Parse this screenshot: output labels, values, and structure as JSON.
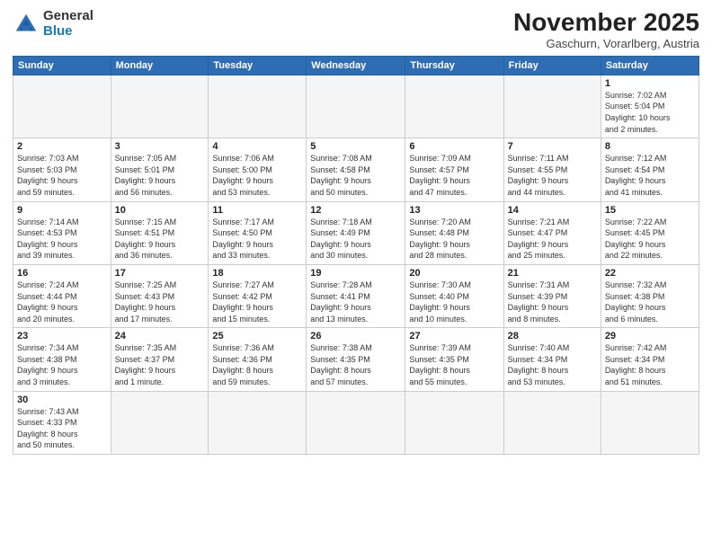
{
  "logo": {
    "text_general": "General",
    "text_blue": "Blue"
  },
  "title": "November 2025",
  "subtitle": "Gaschurn, Vorarlberg, Austria",
  "days_of_week": [
    "Sunday",
    "Monday",
    "Tuesday",
    "Wednesday",
    "Thursday",
    "Friday",
    "Saturday"
  ],
  "weeks": [
    [
      {
        "day": "",
        "info": ""
      },
      {
        "day": "",
        "info": ""
      },
      {
        "day": "",
        "info": ""
      },
      {
        "day": "",
        "info": ""
      },
      {
        "day": "",
        "info": ""
      },
      {
        "day": "",
        "info": ""
      },
      {
        "day": "1",
        "info": "Sunrise: 7:02 AM\nSunset: 5:04 PM\nDaylight: 10 hours\nand 2 minutes."
      }
    ],
    [
      {
        "day": "2",
        "info": "Sunrise: 7:03 AM\nSunset: 5:03 PM\nDaylight: 9 hours\nand 59 minutes."
      },
      {
        "day": "3",
        "info": "Sunrise: 7:05 AM\nSunset: 5:01 PM\nDaylight: 9 hours\nand 56 minutes."
      },
      {
        "day": "4",
        "info": "Sunrise: 7:06 AM\nSunset: 5:00 PM\nDaylight: 9 hours\nand 53 minutes."
      },
      {
        "day": "5",
        "info": "Sunrise: 7:08 AM\nSunset: 4:58 PM\nDaylight: 9 hours\nand 50 minutes."
      },
      {
        "day": "6",
        "info": "Sunrise: 7:09 AM\nSunset: 4:57 PM\nDaylight: 9 hours\nand 47 minutes."
      },
      {
        "day": "7",
        "info": "Sunrise: 7:11 AM\nSunset: 4:55 PM\nDaylight: 9 hours\nand 44 minutes."
      },
      {
        "day": "8",
        "info": "Sunrise: 7:12 AM\nSunset: 4:54 PM\nDaylight: 9 hours\nand 41 minutes."
      }
    ],
    [
      {
        "day": "9",
        "info": "Sunrise: 7:14 AM\nSunset: 4:53 PM\nDaylight: 9 hours\nand 39 minutes."
      },
      {
        "day": "10",
        "info": "Sunrise: 7:15 AM\nSunset: 4:51 PM\nDaylight: 9 hours\nand 36 minutes."
      },
      {
        "day": "11",
        "info": "Sunrise: 7:17 AM\nSunset: 4:50 PM\nDaylight: 9 hours\nand 33 minutes."
      },
      {
        "day": "12",
        "info": "Sunrise: 7:18 AM\nSunset: 4:49 PM\nDaylight: 9 hours\nand 30 minutes."
      },
      {
        "day": "13",
        "info": "Sunrise: 7:20 AM\nSunset: 4:48 PM\nDaylight: 9 hours\nand 28 minutes."
      },
      {
        "day": "14",
        "info": "Sunrise: 7:21 AM\nSunset: 4:47 PM\nDaylight: 9 hours\nand 25 minutes."
      },
      {
        "day": "15",
        "info": "Sunrise: 7:22 AM\nSunset: 4:45 PM\nDaylight: 9 hours\nand 22 minutes."
      }
    ],
    [
      {
        "day": "16",
        "info": "Sunrise: 7:24 AM\nSunset: 4:44 PM\nDaylight: 9 hours\nand 20 minutes."
      },
      {
        "day": "17",
        "info": "Sunrise: 7:25 AM\nSunset: 4:43 PM\nDaylight: 9 hours\nand 17 minutes."
      },
      {
        "day": "18",
        "info": "Sunrise: 7:27 AM\nSunset: 4:42 PM\nDaylight: 9 hours\nand 15 minutes."
      },
      {
        "day": "19",
        "info": "Sunrise: 7:28 AM\nSunset: 4:41 PM\nDaylight: 9 hours\nand 13 minutes."
      },
      {
        "day": "20",
        "info": "Sunrise: 7:30 AM\nSunset: 4:40 PM\nDaylight: 9 hours\nand 10 minutes."
      },
      {
        "day": "21",
        "info": "Sunrise: 7:31 AM\nSunset: 4:39 PM\nDaylight: 9 hours\nand 8 minutes."
      },
      {
        "day": "22",
        "info": "Sunrise: 7:32 AM\nSunset: 4:38 PM\nDaylight: 9 hours\nand 6 minutes."
      }
    ],
    [
      {
        "day": "23",
        "info": "Sunrise: 7:34 AM\nSunset: 4:38 PM\nDaylight: 9 hours\nand 3 minutes."
      },
      {
        "day": "24",
        "info": "Sunrise: 7:35 AM\nSunset: 4:37 PM\nDaylight: 9 hours\nand 1 minute."
      },
      {
        "day": "25",
        "info": "Sunrise: 7:36 AM\nSunset: 4:36 PM\nDaylight: 8 hours\nand 59 minutes."
      },
      {
        "day": "26",
        "info": "Sunrise: 7:38 AM\nSunset: 4:35 PM\nDaylight: 8 hours\nand 57 minutes."
      },
      {
        "day": "27",
        "info": "Sunrise: 7:39 AM\nSunset: 4:35 PM\nDaylight: 8 hours\nand 55 minutes."
      },
      {
        "day": "28",
        "info": "Sunrise: 7:40 AM\nSunset: 4:34 PM\nDaylight: 8 hours\nand 53 minutes."
      },
      {
        "day": "29",
        "info": "Sunrise: 7:42 AM\nSunset: 4:34 PM\nDaylight: 8 hours\nand 51 minutes."
      }
    ],
    [
      {
        "day": "30",
        "info": "Sunrise: 7:43 AM\nSunset: 4:33 PM\nDaylight: 8 hours\nand 50 minutes."
      },
      {
        "day": "",
        "info": ""
      },
      {
        "day": "",
        "info": ""
      },
      {
        "day": "",
        "info": ""
      },
      {
        "day": "",
        "info": ""
      },
      {
        "day": "",
        "info": ""
      },
      {
        "day": "",
        "info": ""
      }
    ]
  ]
}
